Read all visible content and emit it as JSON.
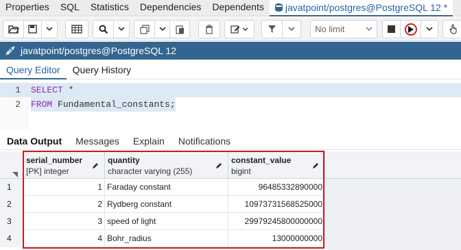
{
  "top_tabs": [
    {
      "label": "Properties"
    },
    {
      "label": "SQL"
    },
    {
      "label": "Statistics"
    },
    {
      "label": "Dependencies"
    },
    {
      "label": "Dependents"
    },
    {
      "label": "javatpoint/postgres@PostgreSQL 12 *"
    }
  ],
  "toolbar": {
    "limit_select": "No limit"
  },
  "connection": {
    "label": "javatpoint/postgres@PostgreSQL 12"
  },
  "sub_tabs": [
    {
      "label": "Query Editor"
    },
    {
      "label": "Query History"
    }
  ],
  "editor": {
    "lines": [
      {
        "number": "1",
        "keyword": "SELECT",
        "rest": " *"
      },
      {
        "number": "2",
        "keyword": "FROM",
        "rest": " Fundamental_constants;"
      }
    ]
  },
  "output_tabs": [
    {
      "label": "Data Output"
    },
    {
      "label": "Messages"
    },
    {
      "label": "Explain"
    },
    {
      "label": "Notifications"
    }
  ],
  "grid": {
    "columns": [
      {
        "name": "serial_number",
        "type": "[PK] integer"
      },
      {
        "name": "quantity",
        "type": "character varying (255)"
      },
      {
        "name": "constant_value",
        "type": "bigint"
      }
    ],
    "rows": [
      {
        "n": "1",
        "serial_number": "1",
        "quantity": "Faraday constant",
        "constant_value": "96485332890000"
      },
      {
        "n": "2",
        "serial_number": "2",
        "quantity": "Rydberg constant",
        "constant_value": "10973731568525000"
      },
      {
        "n": "3",
        "serial_number": "3",
        "quantity": "speed of light",
        "constant_value": "29979245800000000"
      },
      {
        "n": "4",
        "serial_number": "4",
        "quantity": "Bohr_radius",
        "constant_value": "13000000000"
      }
    ]
  },
  "colors": {
    "brand": "#326690",
    "highlight": "#d0161f",
    "keyword": "#8a2aa8"
  }
}
